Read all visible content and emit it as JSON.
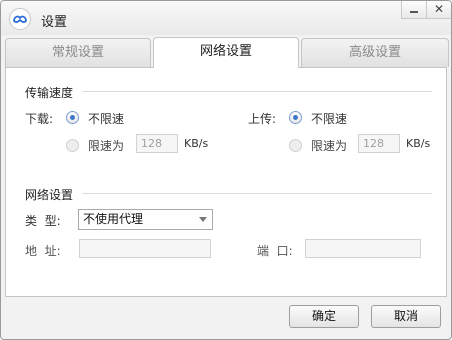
{
  "window": {
    "title": "设置"
  },
  "tabs": [
    "常规设置",
    "网络设置",
    "高级设置"
  ],
  "speed": {
    "section_title": "传输速度",
    "download": {
      "label": "下载:",
      "unlimited": "不限速",
      "limit": "限速为",
      "value": "128",
      "unit": "KB/s"
    },
    "upload": {
      "label": "上传:",
      "unlimited": "不限速",
      "limit": "限速为",
      "value": "128",
      "unit": "KB/s"
    }
  },
  "network": {
    "section_title": "网络设置",
    "type_label": "类  型:",
    "type_value": "不使用代理",
    "address_label": "地  址:",
    "address_value": "",
    "port_label": "端  口:",
    "port_value": ""
  },
  "buttons": {
    "ok": "确定",
    "cancel": "取消"
  }
}
